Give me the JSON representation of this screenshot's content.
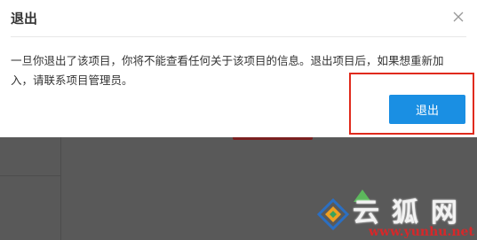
{
  "dialog": {
    "title": "退出",
    "message": "一旦你退出了该项目，你将不能查看任何关于该项目的信息。退出项目后，如果想重新加入，请联系项目管理员。",
    "exit_label": "退出",
    "close_icon": "close-icon"
  },
  "watermark": {
    "brand": "云狐网",
    "url": "www.yunhu.net"
  },
  "colors": {
    "primary_button": "#1a8fe3",
    "highlight_border": "#e02a1c",
    "overlay": "#595959"
  }
}
